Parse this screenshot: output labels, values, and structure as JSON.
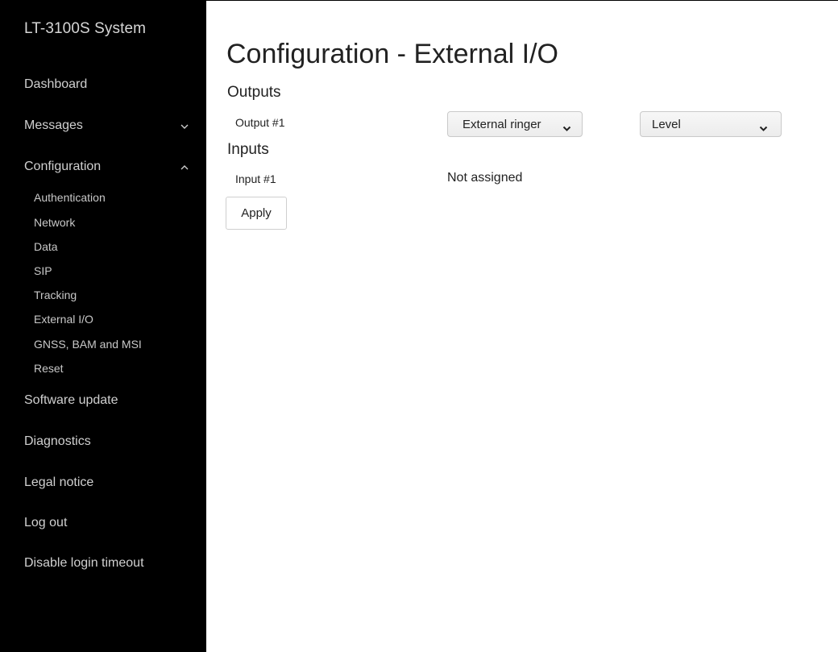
{
  "sidebar": {
    "brand": "LT-3100S System",
    "items": {
      "dashboard": "Dashboard",
      "messages": "Messages",
      "configuration": "Configuration",
      "software_update": "Software update",
      "diagnostics": "Diagnostics",
      "legal_notice": "Legal notice",
      "log_out": "Log out",
      "disable_login_timeout": "Disable login timeout"
    },
    "configuration_subitems": {
      "authentication": "Authentication",
      "network": "Network",
      "data": "Data",
      "sip": "SIP",
      "tracking": "Tracking",
      "external_io": "External I/O",
      "gnss": "GNSS, BAM and MSI",
      "reset": "Reset"
    },
    "icons": {
      "messages_expander": "chevron-down-icon",
      "configuration_expander": "chevron-up-icon"
    }
  },
  "main": {
    "title": "Configuration - External I/O",
    "outputs": {
      "heading": "Outputs",
      "rows": [
        {
          "label": "Output #1",
          "function_value": "External ringer",
          "mode_value": "Level"
        }
      ]
    },
    "inputs": {
      "heading": "Inputs",
      "rows": [
        {
          "label": "Input #1",
          "value": "Not assigned"
        }
      ]
    },
    "apply_label": "Apply"
  },
  "colors": {
    "sidebar_bg": "#000000",
    "sidebar_text": "#d0d0d0",
    "page_bg": "#ffffff",
    "text": "#222222"
  }
}
